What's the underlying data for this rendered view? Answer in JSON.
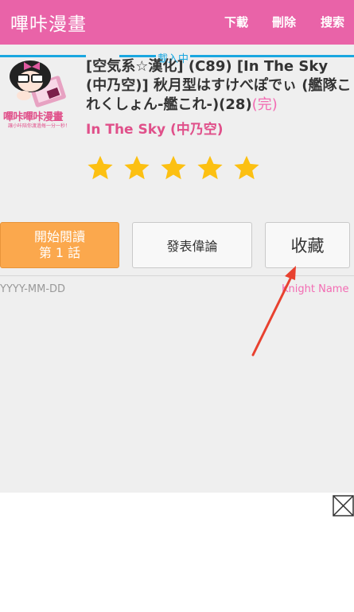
{
  "app": {
    "title": "嗶咔漫畫",
    "actions": {
      "download": "下載",
      "delete": "刪除",
      "search": "搜索"
    },
    "theme_color": "#e963a8"
  },
  "loading": {
    "text": "載入中",
    "color": "#1aa7e0"
  },
  "logo": {
    "text": "嗶咔嗶咔漫畫",
    "subtext": "讓小咔陪你渡過每一分一秒！"
  },
  "comic": {
    "title": "[空気系☆漢化] (C89) [In The Sky (中乃空)] 秋月型はすけべぽでぃ (艦隊これくしょん-艦これ-)(28)",
    "status": "(完)",
    "author": "In The Sky (中乃空)",
    "rating": 5,
    "rating_max": 5
  },
  "buttons": {
    "read_line1": "開始閱讀",
    "read_line2": "第 1 話",
    "comment": "發表偉論",
    "favorite": "收藏"
  },
  "meta": {
    "date": "YYYY-MM-DD",
    "knight_name": "Knight Name"
  }
}
